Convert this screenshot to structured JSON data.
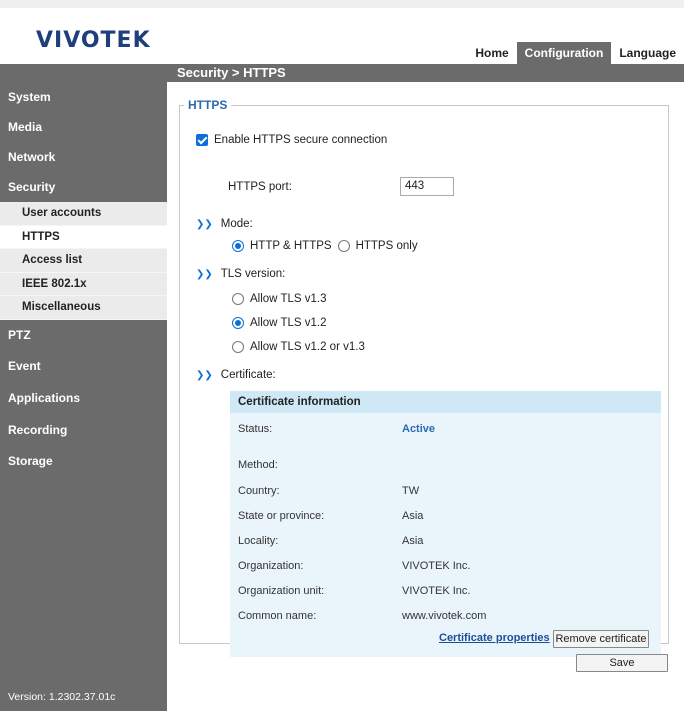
{
  "brand": {
    "logo": "VIVOTEK"
  },
  "topnav": [
    {
      "label": "Home",
      "active": false
    },
    {
      "label": "Configuration",
      "active": true
    },
    {
      "label": "Language",
      "active": false
    }
  ],
  "breadcrumb": "Security  > HTTPS",
  "sidebar": {
    "items": [
      {
        "label": "System"
      },
      {
        "label": "Media"
      },
      {
        "label": "Network"
      },
      {
        "label": "Security"
      }
    ],
    "security_sub": [
      {
        "label": "User accounts",
        "selected": false
      },
      {
        "label": "HTTPS",
        "selected": true
      },
      {
        "label": "Access list",
        "selected": false
      },
      {
        "label": "IEEE 802.1x",
        "selected": false
      },
      {
        "label": "Miscellaneous",
        "selected": false
      }
    ],
    "items_after": [
      {
        "label": "PTZ"
      },
      {
        "label": "Event"
      },
      {
        "label": "Applications"
      },
      {
        "label": "Recording"
      },
      {
        "label": "Storage"
      }
    ],
    "version": "Version: 1.2302.37.01c"
  },
  "https": {
    "legend": "HTTPS",
    "enable_label": "Enable HTTPS secure connection",
    "enable_checked": true,
    "port_label": "HTTPS port:",
    "port_value": "443",
    "mode_label": "Mode:",
    "mode_options": [
      {
        "label": "HTTP & HTTPS",
        "selected": true
      },
      {
        "label": "HTTPS only",
        "selected": false
      }
    ],
    "tls_label": "TLS version:",
    "tls_options": [
      {
        "label": "Allow TLS v1.3",
        "selected": false
      },
      {
        "label": "Allow TLS v1.2",
        "selected": true
      },
      {
        "label": "Allow TLS v1.2 or v1.3",
        "selected": false
      }
    ],
    "cert_label": "Certificate:"
  },
  "certificate": {
    "header": "Certificate information",
    "rows": [
      {
        "label": "Status:",
        "value": "Active"
      },
      {
        "label": "Method:",
        "value": ""
      },
      {
        "label": "Country:",
        "value": "TW"
      },
      {
        "label": "State or province:",
        "value": "Asia"
      },
      {
        "label": "Locality:",
        "value": "Asia"
      },
      {
        "label": "Organization:",
        "value": "VIVOTEK Inc."
      },
      {
        "label": "Organization unit:",
        "value": "VIVOTEK Inc."
      },
      {
        "label": "Common name:",
        "value": "www.vivotek.com"
      }
    ],
    "properties_link": "Certificate properties",
    "remove_button": "Remove certificate"
  },
  "save_button": "Save",
  "colors": {
    "accent": "#0b6fd8",
    "sidebar": "#6b6b6b",
    "cert_bg": "#eaf5fb",
    "cert_head": "#cfe8f5",
    "logo": "#1f3f7a"
  }
}
